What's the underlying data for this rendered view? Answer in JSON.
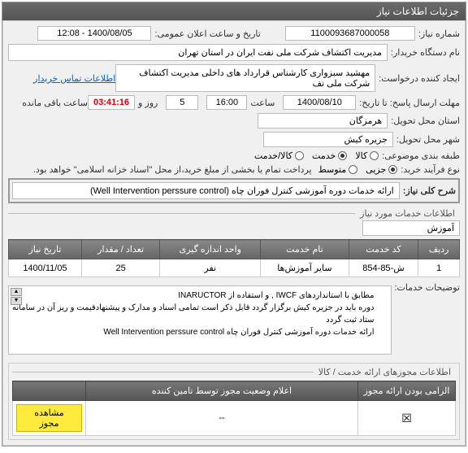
{
  "header": {
    "title": "جزئیات اطلاعات نیاز"
  },
  "fields": {
    "need_no_label": "شماره نیاز:",
    "need_no": "1100093687000058",
    "announce_label": "تاریخ و ساعت اعلان عمومی:",
    "announce": "1400/08/05 - 12:08",
    "buyer_label": "نام دستگاه خریدار:",
    "buyer": "مدیریت اکتشاف شرکت ملی نفت ایران در استان تهران",
    "creator_label": "ایجاد کننده درخواست:",
    "creator": "مهشید سبزواری کارشناس قرارداد های داخلی مدیریت اکتشاف شرکت ملی نف",
    "contact_link": "اطلاعات تماس خریدار",
    "deadline_label": "مهلت ارسال پاسخ: تا تاریخ:",
    "deadline_date": "1400/08/10",
    "time_label": "ساعت",
    "deadline_time": "16:00",
    "days": "5",
    "days_label": "روز و",
    "countdown": "03:41:16",
    "countdown_label": "ساعت باقی مانده",
    "province_label": "استان محل تحویل:",
    "province": "هرمزگان",
    "city_label": "شهر محل تحویل:",
    "city": "جزیره کیش",
    "category_label": "طبقه بندی موضوعی:",
    "cat_kala": "کالا",
    "cat_khadamat": "خدمت",
    "cat_both": "کالا/خدمت",
    "process_label": "نوع فرآیند خرید:",
    "proc_minor": "جزیی",
    "proc_medium": "متوسط",
    "proc_note": "پرداخت تمام یا بخشی از مبلغ خرید،از محل \"اسناد خزانه اسلامی\" خواهد بود.",
    "desc_label": "شرح کلی نیاز:",
    "desc": "ارائه خدمات دوره آموزشی کنترل فوران چاه (Well Intervention perssure  control)"
  },
  "services": {
    "section_title": "اطلاعات خدمات مورد نیاز",
    "tab": "آموزش",
    "headers": {
      "row": "ردیف",
      "code": "کد خدمت",
      "name": "نام خدمت",
      "unit": "واحد اندازه گیری",
      "qty": "تعداد / مقدار",
      "date": "تاریخ نیاز"
    },
    "rows": [
      {
        "row": "1",
        "code": "ش-85-854",
        "name": "سایر آموزش‌ها",
        "unit": "نفر",
        "qty": "25",
        "date": "1400/11/05"
      }
    ],
    "notes_label": "توضیحات خدمات:",
    "notes": "مطابق با استانداردهای IWCF  , و استفاده از INARUCTOR\nدوره باید در جزیره کیش برگزار گردد قابل ذکر است تمامی اسناد و مدارک و پیشنهادقیمت و ریز آن در سامانه ستاد ثبت گردد\nارائه خدمات دوره آموزشی کنترل فوران چاه Well Intervention perssure  control"
  },
  "auth": {
    "section_title": "اطلاعات مجوزهای ارائه خدمت / کالا",
    "headers": {
      "mandatory": "الزامی بودن ارائه مجوز",
      "status": "اعلام وضعیت مجوز توسط تامین کننده",
      "action": ""
    },
    "rows": [
      {
        "mandatory": "☒",
        "status": "--",
        "action": "مشاهده مجوز"
      }
    ]
  }
}
